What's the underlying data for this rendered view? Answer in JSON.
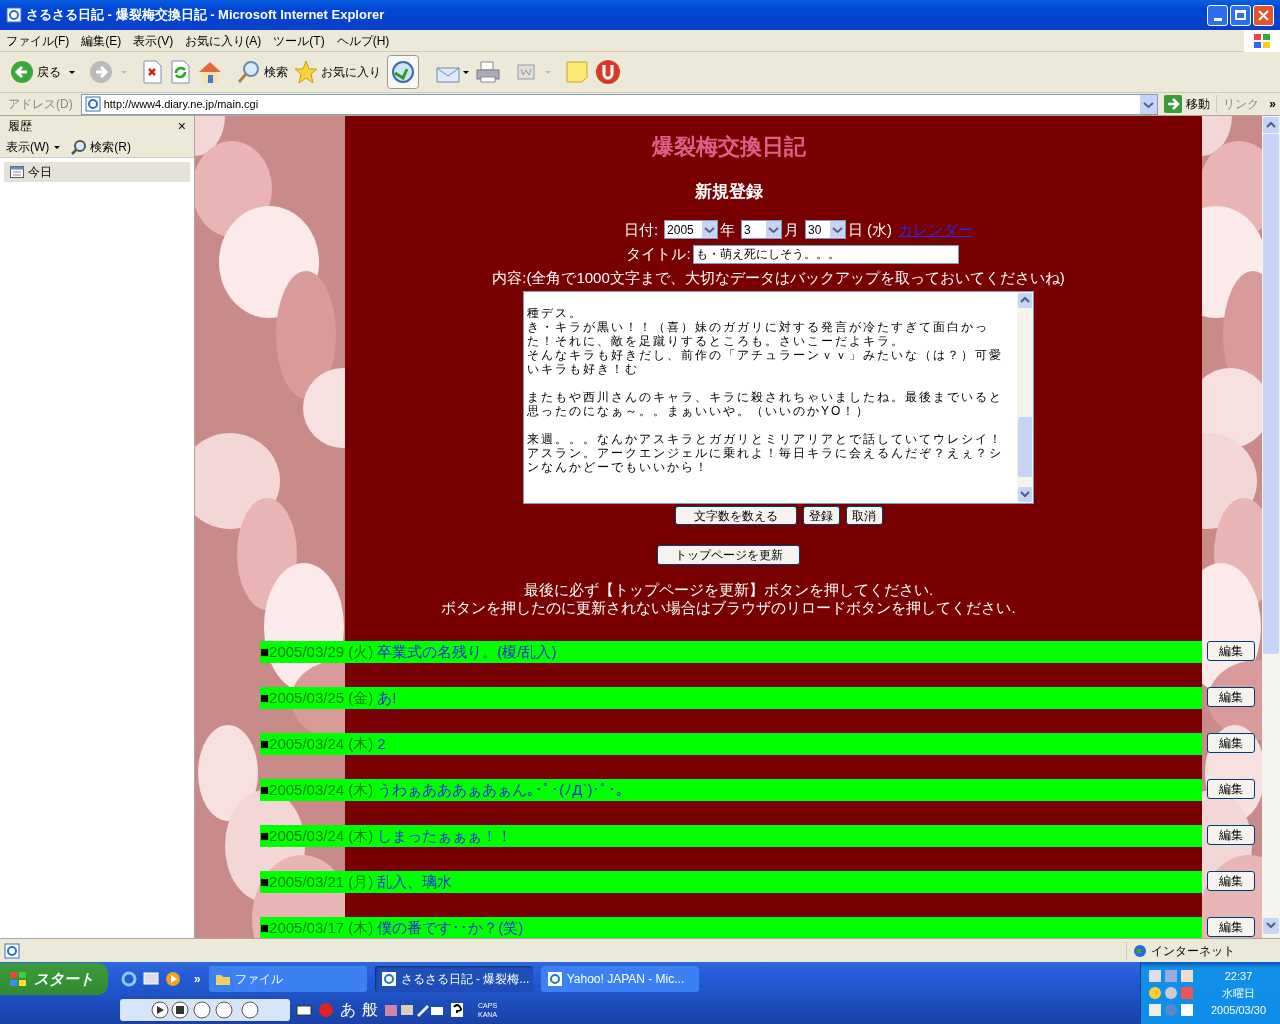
{
  "window": {
    "title": "さるさる日記 - 爆裂梅交換日記 - Microsoft Internet Explorer"
  },
  "menu": [
    "ファイル(F)",
    "編集(E)",
    "表示(V)",
    "お気に入り(A)",
    "ツール(T)",
    "ヘルプ(H)"
  ],
  "toolbar": {
    "back": "戻る",
    "search": "検索",
    "favorites": "お気に入り"
  },
  "address": {
    "label": "アドレス(D)",
    "url": "http://www4.diary.ne.jp/main.cgi",
    "go": "移動",
    "links": "リンク",
    "more": "»"
  },
  "sidebar": {
    "title": "履歴",
    "close": "×",
    "view": "表示(W)",
    "search": "検索(R)",
    "items": [
      {
        "label": "今日",
        "selected": true
      }
    ]
  },
  "page": {
    "site_title": "爆裂梅交換日記",
    "heading": "新規登録",
    "date": {
      "label": "日付:",
      "year": "2005",
      "year_unit": "年",
      "month": "3",
      "month_unit": "月",
      "day": "30",
      "day_unit": "日",
      "weekday": "(水)",
      "calendar_link": "カレンダー"
    },
    "title_label": "タイトル:",
    "title_value": "も・萌え死にしそう。。。",
    "content_label": "内容:(全角で1000文字まで、大切なデータはバックアップを取っておいてくださいね)",
    "content": [
      {
        "lines": [
          "種デス。",
          "き・キラが黒い！！（喜）妹のガガリに対する発言が冷たすぎて面白かった！それに、敵を足蹴りするところも。さいこーだよキラ。",
          "そんなキラも好きだし、前作の「アチュラーンｖｖ」みたいな（は？）可愛いキラも好き！む"
        ]
      },
      {
        "lines": [
          "またもや西川さんのキャラ、キラに殺されちゃいましたね。最後までいると思ったのになぁ～。。まぁいいや。（いいのかYO！）"
        ]
      },
      {
        "lines": [
          "来週。。。なんかアスキラとガガリとミリアリアとで話していてウレシイ！アスラン。アークエンジェルに乗れよ！毎日キラに会えるんだぞ？えぇ？シンなんかどーでもいいから！"
        ]
      }
    ],
    "buttons": [
      "文字数を数える",
      "登録",
      "取消"
    ],
    "update_button": "トップページを更新",
    "notes": [
      "最後に必ず【トップページを更新】ボタンを押してください.",
      "ボタンを押したのに更新されない場合はブラウザのリロードボタンを押してください."
    ],
    "entries": [
      {
        "marker": "■",
        "date": "2005/03/29 (火)",
        "title": "卒業式の名残り。(榎/乱入)",
        "edit": "編集"
      },
      {
        "marker": "■",
        "date": "2005/03/25 (金)",
        "title": "あ!",
        "edit": "編集"
      },
      {
        "marker": "■",
        "date": "2005/03/24 (木)",
        "title": "2",
        "edit": "編集"
      },
      {
        "marker": "■",
        "date": "2005/03/24 (木)",
        "title": "うわぁあああぁあぁん｡･ﾟ･(ﾉД`)･ﾟ･｡",
        "edit": "編集"
      },
      {
        "marker": "■",
        "date": "2005/03/24 (木)",
        "title": "しまったぁぁぁ！！",
        "edit": "編集"
      },
      {
        "marker": "■",
        "date": "2005/03/21 (月)",
        "title": "乱入、璃水",
        "edit": "編集"
      },
      {
        "marker": "■",
        "date": "2005/03/17 (木)",
        "title": "僕の番です･･か？(笑)",
        "edit": "編集"
      }
    ]
  },
  "status_bar": {
    "zone": "インターネット"
  },
  "taskbar": {
    "start": "スタート",
    "more": "»",
    "tasks": [
      {
        "label": "ファイル",
        "selected": false
      },
      {
        "label": "さるさる日記 - 爆裂梅...",
        "selected": true
      },
      {
        "label": "Yahoo! JAPAN - Mic...",
        "selected": false
      }
    ],
    "language_bar": {
      "ime": "あ",
      "mode": "般",
      "caps": "CAPS",
      "kana": "KANA"
    },
    "clock": {
      "time": "22:37",
      "weekday": "水曜日",
      "date": "2005/03/30"
    }
  }
}
